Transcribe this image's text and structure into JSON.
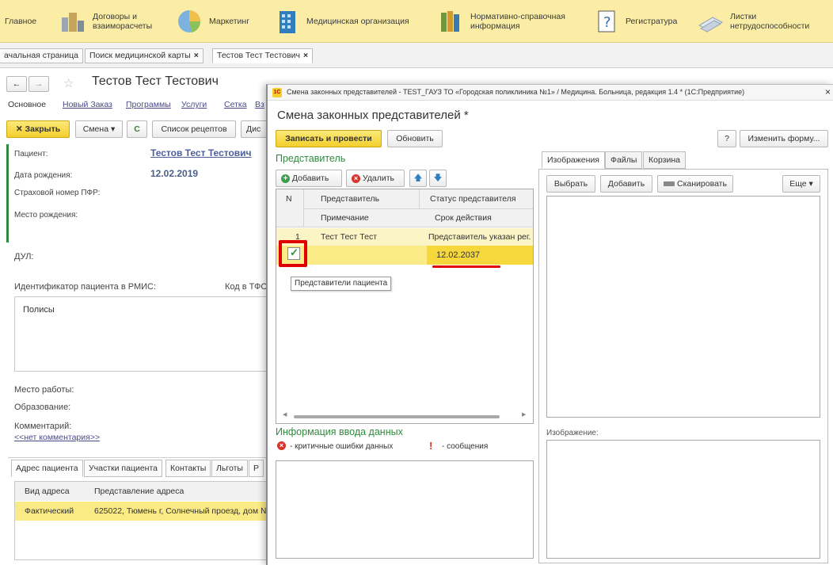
{
  "top_sections": [
    {
      "label": "Главное",
      "icon": "home-icon"
    },
    {
      "label": "Договоры и\nвзаиморасчеты",
      "icon": "coins-icon"
    },
    {
      "label": "Маркетинг",
      "icon": "pie-chart-icon"
    },
    {
      "label": "Медицинская организация",
      "icon": "building-icon"
    },
    {
      "label": "Нормативно-справочная\nинформация",
      "icon": "books-icon"
    },
    {
      "label": "Регистратура",
      "icon": "notepad-icon"
    },
    {
      "label": "Листки\nнетрудоспособности",
      "icon": "papers-icon"
    }
  ],
  "tabs": [
    {
      "label": "ачальная страница"
    },
    {
      "label": "Поиск медицинской карты",
      "close": "×"
    },
    {
      "label": "Тестов Тест Тестович",
      "close": "×"
    }
  ],
  "patient_form": {
    "title": "Тестов Тест Тестович",
    "nav": [
      "Основное",
      "Новый Заказ",
      "Программы",
      "Услуги",
      "Сетка",
      "Вз"
    ],
    "toolbar": {
      "close": "Закрыть",
      "shift": "Смена",
      "refresh": "C",
      "recipes": "Список рецептов",
      "more": "Дис"
    },
    "fields": {
      "patient_label": "Пациент:",
      "patient_value": "Тестов Тест Тестович",
      "dob_label": "Дата рождения:",
      "dob_value": "12.02.2019",
      "snils_label": "Страховой номер ПФР:",
      "birthplace_label": "Место рождения:",
      "dul_label": "ДУЛ:",
      "rmis_label": "Идентификатор пациента в РМИС:",
      "tfoms_label": "Код в ТФО",
      "policies_label": "Полисы",
      "work_label": "Место работы:",
      "education_label": "Образование:",
      "comment_label": "Комментарий:",
      "comment_link": "<<нет комментария>>"
    },
    "bottom_tabs": [
      "Адрес пациента",
      "Участки пациента",
      "Контакты",
      "Льготы",
      "Р"
    ],
    "address_table": {
      "columns": [
        "Вид адреса",
        "Представление адреса"
      ],
      "rows": [
        [
          "Фактический",
          "625022, Тюмень г, Солнечный проезд, дом №"
        ]
      ]
    }
  },
  "modal": {
    "window_title": "Смена законных представителей - TEST_ГАУЗ ТО «Городская поликлиника №1» / Медицина. Больница, редакция 1.4 * (1С:Предприятие)",
    "close": "×",
    "heading": "Смена законных представителей *",
    "save_button": "Записать и провести",
    "refresh_button": "Обновить",
    "help_button": "?",
    "change_form_button": "Изменить форму...",
    "representatives_title": "Представитель",
    "add_button": "Добавить",
    "delete_button": "Удалить",
    "grid": {
      "col_n": "N",
      "col_rep": "Представитель",
      "col_status": "Статус представителя",
      "col_note": "Примечание",
      "col_term": "Срок действия",
      "row": {
        "n": "1",
        "rep": "Тест Тест Тест",
        "status": "Представитель указан рег.",
        "term": "12.02.2037"
      }
    },
    "tooltip": "Представители пациента",
    "info_title": "Информация ввода данных",
    "legend_errors": "- критичные ошибки данных",
    "legend_messages": "- сообщения",
    "right_tabs": [
      "Изображения",
      "Файлы",
      "Корзина"
    ],
    "select_button": "Выбрать",
    "add_image_button": "Добавить",
    "scan_button": "Сканировать",
    "more_button": "Еще",
    "image_label": "Изображение:"
  },
  "colors": {
    "accent_yellow": "#f3cf2c",
    "row_highlight": "#fbeb86",
    "annotation_red": "#e00000",
    "section_green": "#2e8b3d"
  }
}
